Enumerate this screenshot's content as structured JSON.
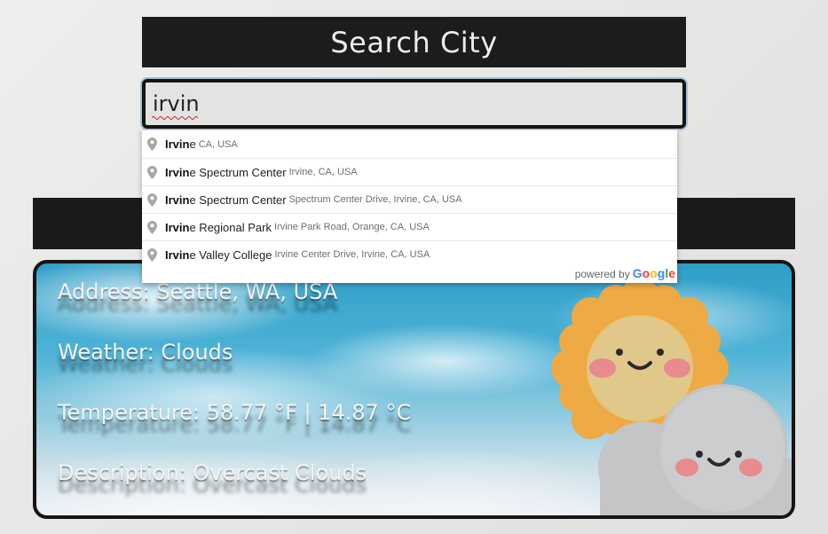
{
  "header": {
    "title": "Search City"
  },
  "search": {
    "value": "irvin"
  },
  "autocomplete": {
    "items": [
      {
        "match": "Irvin",
        "rest": "e",
        "secondary": "CA, USA"
      },
      {
        "match": "Irvin",
        "rest": "e Spectrum Center",
        "secondary": "Irvine, CA, USA"
      },
      {
        "match": "Irvin",
        "rest": "e Spectrum Center",
        "secondary": "Spectrum Center Drive, Irvine, CA, USA"
      },
      {
        "match": "Irvin",
        "rest": "e Regional Park",
        "secondary": "Irvine Park Road, Orange, CA, USA"
      },
      {
        "match": "Irvin",
        "rest": "e Valley College",
        "secondary": "Irvine Center Drive, Irvine, CA, USA"
      }
    ],
    "powered_by": "powered by",
    "brand_letters": [
      "G",
      "o",
      "o",
      "g",
      "l",
      "e"
    ],
    "icon": "map-pin-icon"
  },
  "weather": {
    "address": "Address: Seattle, WA, USA",
    "weather": "Weather: Clouds",
    "temperature": "Temperature: 58.77 °F | 14.87 °C",
    "description": "Description: Overcast Clouds",
    "icon": "sun-behind-cloud-icon"
  },
  "colors": {
    "bar": "#1c1c1a",
    "sun": "#f0b24c",
    "cloud": "#c9cbcd",
    "cheek": "#e98a8f"
  }
}
